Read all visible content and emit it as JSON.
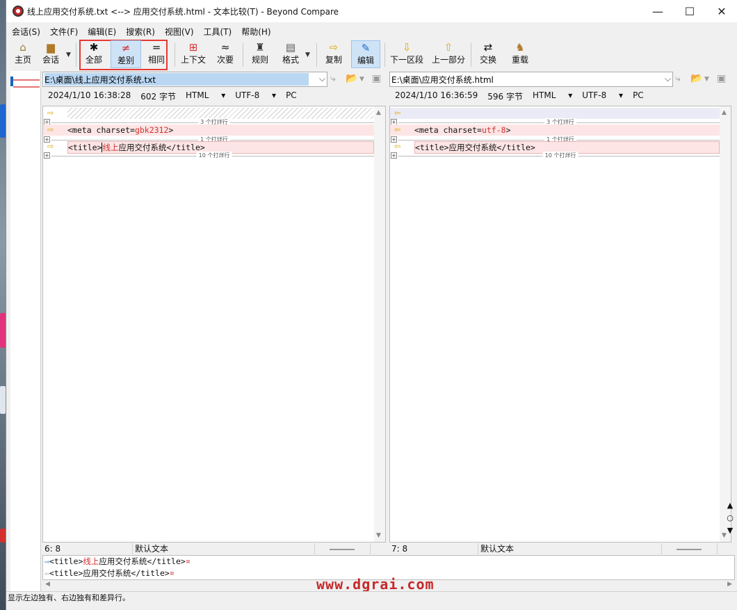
{
  "window": {
    "title": "线上应用交付系统.txt <--> 应用交付系统.html - 文本比较(T) - Beyond Compare",
    "controls": {
      "minimize": "—",
      "maximize": "☐",
      "close": "✕"
    }
  },
  "menu": [
    "会话(S)",
    "文件(F)",
    "编辑(E)",
    "搜索(R)",
    "视图(V)",
    "工具(T)",
    "帮助(H)"
  ],
  "toolbar": {
    "home": "主页",
    "session": "会话",
    "all": "全部",
    "diffs": "差别",
    "same": "相同",
    "context": "上下文",
    "minor": "次要",
    "rules": "规则",
    "format": "格式",
    "copy": "复制",
    "edit": "编辑",
    "next_section": "下一区段",
    "prev_part": "上一部分",
    "swap": "交换",
    "reload": "重载"
  },
  "left": {
    "path": "E:\\桌面\\线上应用交付系统.txt",
    "date": "2024/1/10 16:38:28",
    "size": "602 字节",
    "format": "HTML",
    "encoding": "UTF-8",
    "line_end": "PC",
    "line1_prefix": "<meta charset=",
    "line1_value": "gbk2312",
    "line1_suffix": ">",
    "line2_open": "<title>",
    "line2_diff": "线上",
    "line2_rest": "应用交付系统",
    "line2_close": "</title>",
    "cursor": "6: 8",
    "text_type": "默认文本"
  },
  "right": {
    "path": "E:\\桌面\\应用交付系统.html",
    "date": "2024/1/10 16:36:59",
    "size": "596 字节",
    "format": "HTML",
    "encoding": "UTF-8",
    "line_end": "PC",
    "line1_prefix": "<meta charset=",
    "line1_value": "utf-8",
    "line1_suffix": ">",
    "line2_open": "<title>",
    "line2_rest": "应用交付系统",
    "line2_close": "</title>",
    "cursor": "7: 8",
    "text_type": "默认文本"
  },
  "folds": {
    "f1": "3 个打烊行",
    "f2": "1 个打烊行",
    "f3": "10 个打烊行"
  },
  "detail": {
    "line1_open": "<title>",
    "line1_diff": "线上",
    "line1_rest": "应用交付系统</title>",
    "line2": "<title>应用交付系统</title>",
    "eol": "¤"
  },
  "watermark": "www.dgrai.com",
  "status": "显示左边独有、右边独有和差异行。"
}
